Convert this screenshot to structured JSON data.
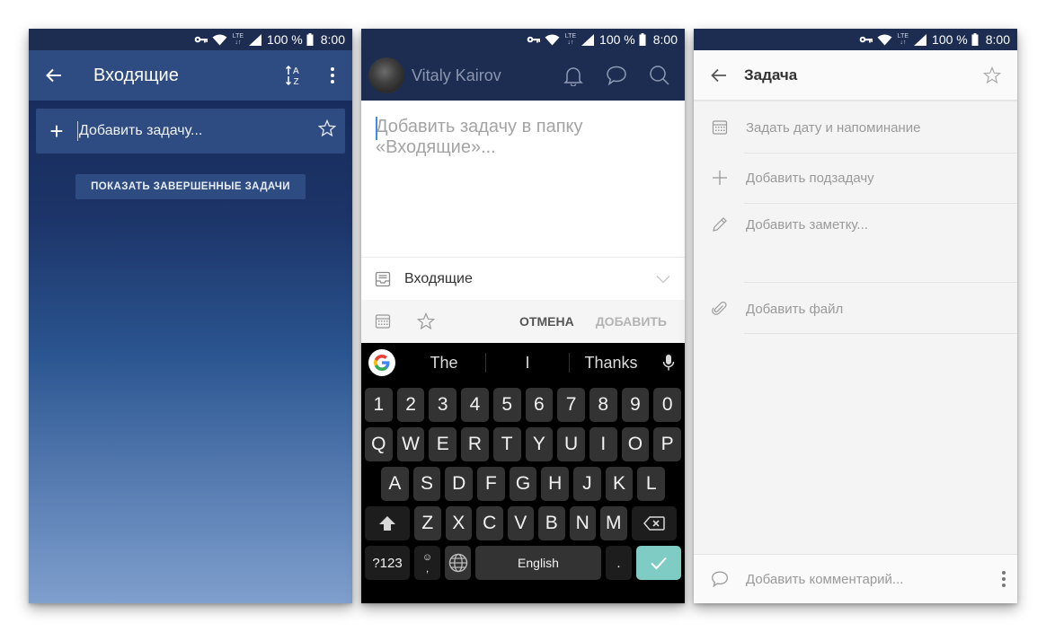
{
  "status_bar": {
    "battery_percent": "100 %",
    "time": "8:00",
    "network": "LTE",
    "icons": [
      "vpn-key-icon",
      "wifi-icon",
      "lte-icon",
      "signal-icon",
      "battery-icon"
    ]
  },
  "panel_inbox": {
    "title": "Входящие",
    "back_icon": "arrow-left-icon",
    "sort_icon": "sort-az-icon",
    "more_icon": "more-vertical-icon",
    "add_task_placeholder": "Добавить задачу...",
    "show_completed_label": "ПОКАЗАТЬ ЗАВЕРШЕННЫЕ ЗАДАЧИ",
    "colors": {
      "appbar": "#2f4c82",
      "gradient_top": "#17295a",
      "gradient_bottom": "#7f9fcd"
    }
  },
  "panel_add": {
    "user_name": "Vitaly Kairov",
    "header_icons": [
      "bell-icon",
      "chat-icon",
      "search-icon"
    ],
    "task_placeholder": "Добавить задачу в папку «Входящие»...",
    "folder_name": "Входящие",
    "cancel_label": "ОТМЕНА",
    "add_label": "ДОБАВИТЬ",
    "keyboard": {
      "suggestions": [
        "The",
        "I",
        "Thanks"
      ],
      "rows": [
        [
          "1",
          "2",
          "3",
          "4",
          "5",
          "6",
          "7",
          "8",
          "9",
          "0"
        ],
        [
          "Q",
          "W",
          "E",
          "R",
          "T",
          "Y",
          "U",
          "I",
          "O",
          "P"
        ],
        [
          "A",
          "S",
          "D",
          "F",
          "G",
          "H",
          "J",
          "K",
          "L"
        ],
        [
          "Z",
          "X",
          "C",
          "V",
          "B",
          "N",
          "M"
        ]
      ],
      "symbols_label": "?123",
      "comma_label": ",",
      "space_label": "English",
      "period_label": ".",
      "enter_color": "#7fccc5"
    }
  },
  "panel_task": {
    "title": "Задача",
    "rows": [
      {
        "icon": "calendar-icon",
        "label": "Задать дату и напоминание"
      },
      {
        "icon": "plus-icon",
        "label": "Добавить подзадачу"
      },
      {
        "icon": "pencil-icon",
        "label": "Добавить заметку..."
      },
      {
        "icon": "paperclip-icon",
        "label": "Добавить файл"
      }
    ],
    "comment_placeholder": "Добавить комментарий..."
  }
}
